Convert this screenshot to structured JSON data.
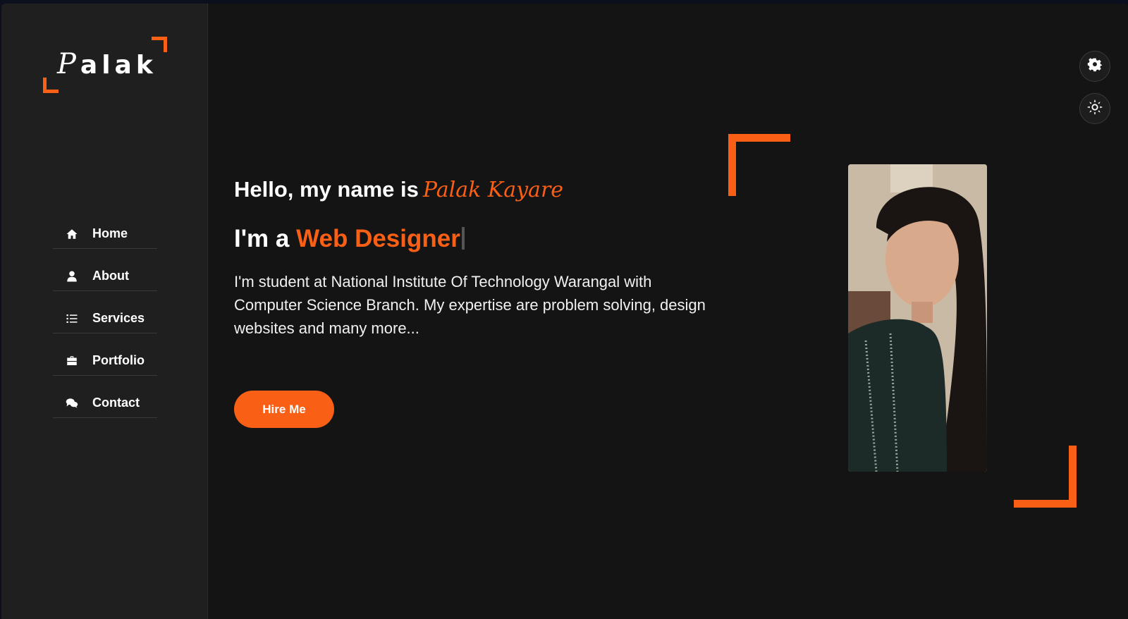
{
  "logo": {
    "first_letter": "P",
    "rest": "alak"
  },
  "nav": {
    "items": [
      {
        "label": "Home",
        "icon": "home-icon"
      },
      {
        "label": "About",
        "icon": "user-icon"
      },
      {
        "label": "Services",
        "icon": "list-icon"
      },
      {
        "label": "Portfolio",
        "icon": "briefcase-icon"
      },
      {
        "label": "Contact",
        "icon": "comments-icon"
      }
    ]
  },
  "hero": {
    "greeting": "Hello, my name is",
    "name": "Palak Kayare",
    "role_prefix": "I'm a",
    "role": "Web Designer",
    "description": "I'm student at National Institute Of Technology Warangal with Computer Science Branch. My expertise are problem solving, design websites and many more...",
    "cta_label": "Hire Me"
  },
  "toggles": [
    {
      "icon": "gear-icon"
    },
    {
      "icon": "sun-icon"
    }
  ],
  "colors": {
    "accent": "#f95f15",
    "background": "#141414",
    "sidebar": "#1f1f1f"
  }
}
